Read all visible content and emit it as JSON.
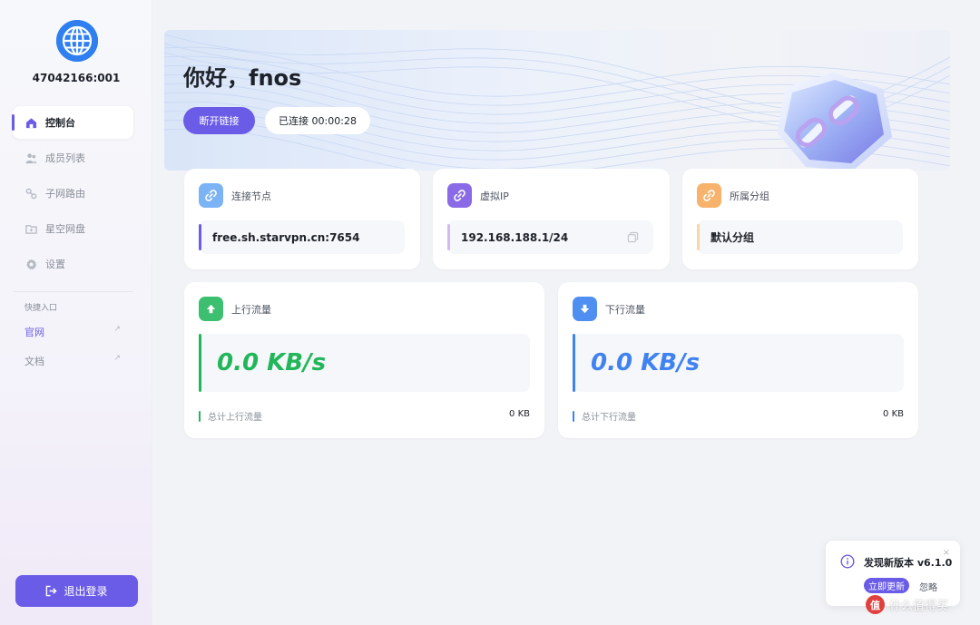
{
  "sidebar": {
    "node_id": "47042166:001",
    "nav": [
      {
        "label": "控制台",
        "icon": "home-icon"
      },
      {
        "label": "成员列表",
        "icon": "users-icon"
      },
      {
        "label": "子网路由",
        "icon": "route-icon"
      },
      {
        "label": "星空网盘",
        "icon": "folder-icon"
      },
      {
        "label": "设置",
        "icon": "gear-icon"
      }
    ],
    "quick_title": "快捷入口",
    "quick_links": [
      {
        "label": "官网",
        "arrow": "↗"
      },
      {
        "label": "文档",
        "arrow": "↗"
      }
    ],
    "logout_label": "退出登录"
  },
  "header": {
    "greeting": "你好，fnos",
    "disconnect_label": "断开链接",
    "status_text": "已连接 00:00:28"
  },
  "info_cards": [
    {
      "title": "连接节点",
      "value": "free.sh.starvpn.cn:7654",
      "icon": "link-icon"
    },
    {
      "title": "虚拟IP",
      "value": "192.168.188.1/24",
      "icon": "link-icon"
    },
    {
      "title": "所属分组",
      "value": "默认分组",
      "icon": "link-icon"
    }
  ],
  "traffic": {
    "up": {
      "title": "上行流量",
      "speed": "0.0 KB/s",
      "total_label": "总计上行流量",
      "total_value": "0 KB"
    },
    "down": {
      "title": "下行流量",
      "speed": "0.0 KB/s",
      "total_label": "总计下行流量",
      "total_value": "0 KB"
    }
  },
  "toast": {
    "title": "发现新版本 v6.1.0",
    "update_label": "立即更新",
    "ignore_label": "忽略",
    "close": "×"
  },
  "watermark": {
    "badge": "值",
    "text": "什么值得买"
  },
  "colors": {
    "accent": "#6b5ce7",
    "up_green": "#22b65a",
    "down_blue": "#3f82f0"
  }
}
